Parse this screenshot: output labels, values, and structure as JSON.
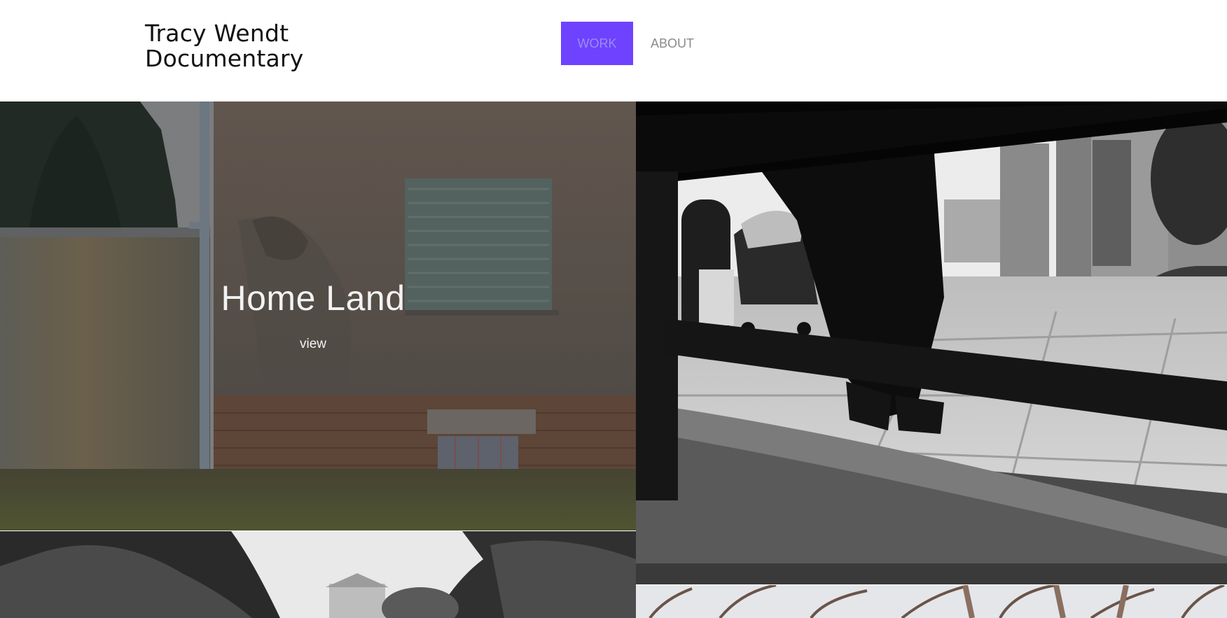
{
  "site": {
    "title_line1": "Tracy Wendt",
    "title_line2": "Documentary"
  },
  "nav": {
    "items": [
      {
        "label": "WORK",
        "active": true
      },
      {
        "label": "ABOUT",
        "active": false
      }
    ],
    "accent_color": "#6f42ff"
  },
  "projects": [
    {
      "title": "Home Land",
      "link_label": "view"
    }
  ]
}
